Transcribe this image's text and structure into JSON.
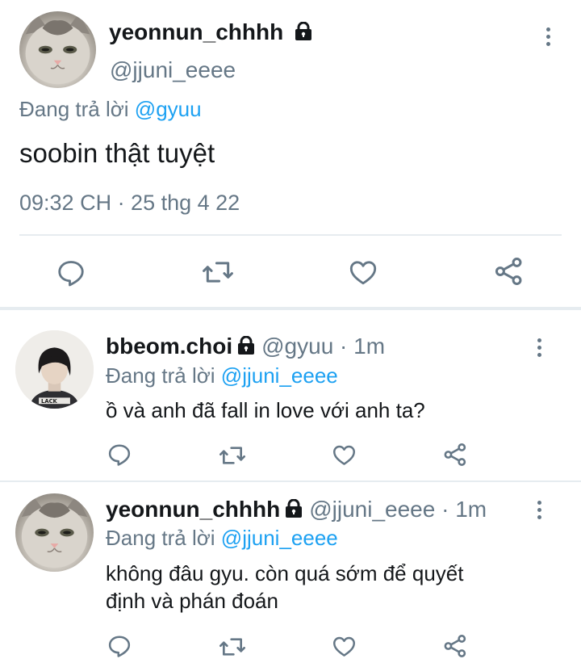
{
  "main_tweet": {
    "display_name": "yeonnun_chhhh",
    "handle": "@jjuni_eeee",
    "reply_prefix": "Đang trả lời",
    "reply_to": "@gyuu",
    "text": "soobin thật tuyệt",
    "timestamp": "09:32 CH · 25 thg 4 22",
    "icons": [
      "comment-icon",
      "retweet-icon",
      "heart-icon",
      "share-icon",
      "more-vertical-icon",
      "lock-icon"
    ]
  },
  "replies": [
    {
      "display_name": "bbeom.choi",
      "handle": "@gyuu",
      "time": "· 1m",
      "reply_prefix": "Đang trả lời",
      "reply_to": "@jjuni_eeee",
      "text_line1": "ồ và anh đã fall in love với anh ta?",
      "text_line2": ""
    },
    {
      "display_name": "yeonnun_chhhh",
      "handle": "@jjuni_eeee",
      "time": "· 1m",
      "reply_prefix": "Đang trả lời",
      "reply_to": "@jjuni_eeee",
      "text_line1": "không đâu gyu. còn quá sớm để quyết",
      "text_line2": "định và phán đoán"
    }
  ],
  "colors": {
    "accent": "#1da1f2",
    "muted": "#657786",
    "divider": "#e6ecf0",
    "text": "#14171a"
  }
}
